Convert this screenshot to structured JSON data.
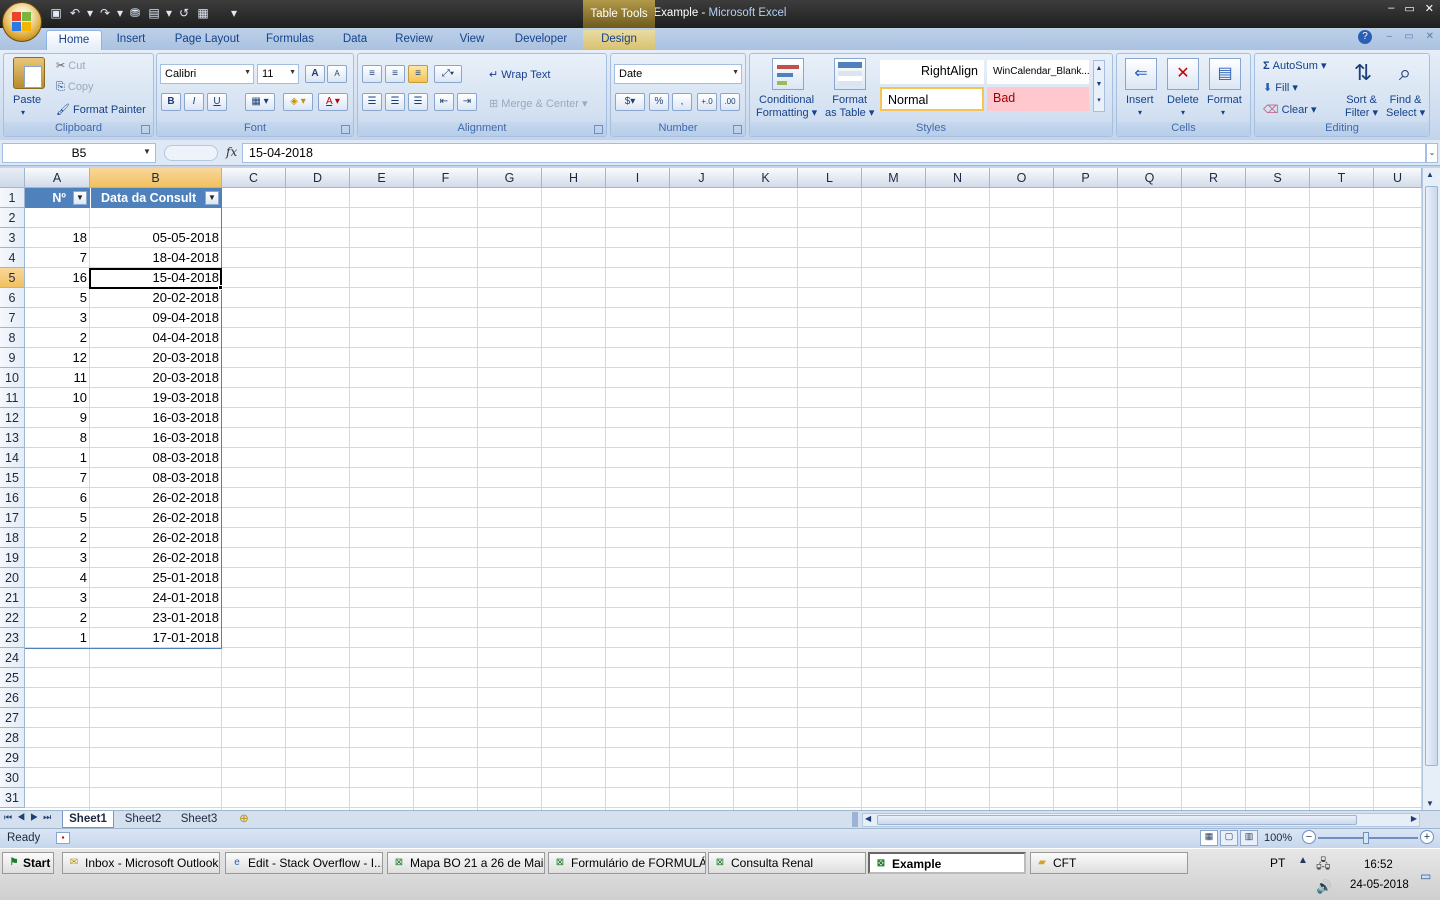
{
  "window": {
    "doc": "Example",
    "sep": " - ",
    "app": "Microsoft Excel",
    "context_tab": "Table Tools",
    "min": "–",
    "max": "▭",
    "close": "✕"
  },
  "ribbon_tabs": [
    "Home",
    "Insert",
    "Page Layout",
    "Formulas",
    "Data",
    "Review",
    "View",
    "Developer",
    "Design"
  ],
  "clipboard": {
    "paste": "Paste",
    "cut": "Cut",
    "copy": "Copy",
    "format_painter": "Format Painter",
    "label": "Clipboard"
  },
  "font": {
    "name": "Calibri",
    "size": "11",
    "label": "Font",
    "bold": "B",
    "italic": "I",
    "underline": "U",
    "grow": "A",
    "shrink": "A"
  },
  "alignment": {
    "wrap": "Wrap Text",
    "merge": "Merge & Center",
    "label": "Alignment"
  },
  "number": {
    "format": "Date",
    "percent": "%",
    "comma": ",",
    "inc": "+.0",
    "dec": ".00",
    "label": "Number"
  },
  "styles": {
    "cond": "Conditional",
    "cond2": "Formatting",
    "fmt_table": "Format",
    "fmt_table2": "as Table",
    "right_align": "RightAlign",
    "wincal": "WinCalendar_Blank...",
    "normal": "Normal",
    "bad": "Bad",
    "label": "Styles"
  },
  "cells": {
    "insert": "Insert",
    "delete": "Delete",
    "format": "Format",
    "label": "Cells"
  },
  "editing": {
    "autosum": "AutoSum",
    "fill": "Fill",
    "clear": "Clear",
    "sort": "Sort &",
    "sort2": "Filter",
    "find": "Find &",
    "find2": "Select",
    "label": "Editing"
  },
  "formula_bar": {
    "name_box": "B5",
    "fx": "fx",
    "value": "15-04-2018"
  },
  "columns": [
    "A",
    "B",
    "C",
    "D",
    "E",
    "F",
    "G",
    "H",
    "I",
    "J",
    "K",
    "L",
    "M",
    "N",
    "O",
    "P",
    "Q",
    "R",
    "S",
    "T",
    "U"
  ],
  "rows": [
    "1",
    "2",
    "3",
    "4",
    "5",
    "6",
    "7",
    "8",
    "9",
    "10",
    "11",
    "12",
    "13",
    "14",
    "15",
    "16",
    "17",
    "18",
    "19",
    "20",
    "21",
    "22",
    "23",
    "24",
    "25",
    "26",
    "27",
    "28",
    "29",
    "30",
    "31"
  ],
  "table_headers": {
    "a": "Nº",
    "b": "Data da Consult"
  },
  "table_rows": [
    {
      "n": "18",
      "d": "05-05-2018"
    },
    {
      "n": "7",
      "d": "18-04-2018"
    },
    {
      "n": "16",
      "d": "15-04-2018"
    },
    {
      "n": "5",
      "d": "20-02-2018"
    },
    {
      "n": "3",
      "d": "09-04-2018"
    },
    {
      "n": "2",
      "d": "04-04-2018"
    },
    {
      "n": "12",
      "d": "20-03-2018"
    },
    {
      "n": "11",
      "d": "20-03-2018"
    },
    {
      "n": "10",
      "d": "19-03-2018"
    },
    {
      "n": "9",
      "d": "16-03-2018"
    },
    {
      "n": "8",
      "d": "16-03-2018"
    },
    {
      "n": "1",
      "d": "08-03-2018"
    },
    {
      "n": "7",
      "d": "08-03-2018"
    },
    {
      "n": "6",
      "d": "26-02-2018"
    },
    {
      "n": "5",
      "d": "26-02-2018"
    },
    {
      "n": "2",
      "d": "26-02-2018"
    },
    {
      "n": "3",
      "d": "26-02-2018"
    },
    {
      "n": "4",
      "d": "25-01-2018"
    },
    {
      "n": "3",
      "d": "24-01-2018"
    },
    {
      "n": "2",
      "d": "23-01-2018"
    },
    {
      "n": "1",
      "d": "17-01-2018"
    }
  ],
  "sheets": [
    "Sheet1",
    "Sheet2",
    "Sheet3"
  ],
  "status": {
    "ready": "Ready",
    "zoom": "100%"
  },
  "taskbar": {
    "start": "Start",
    "items": [
      "Inbox - Microsoft Outlook",
      "Edit - Stack Overflow - I...",
      "Mapa BO 21 a 26 de Mai...",
      "Formulário de FORMULÁ...",
      "Consulta Renal",
      "Example",
      "CFT"
    ],
    "lang": "PT",
    "time": "16:52",
    "date": "24-05-2018"
  },
  "colors": {
    "table_header": "#4f81bd",
    "selected_header": "#f1c15f",
    "bad_style": "#ffc7ce"
  }
}
